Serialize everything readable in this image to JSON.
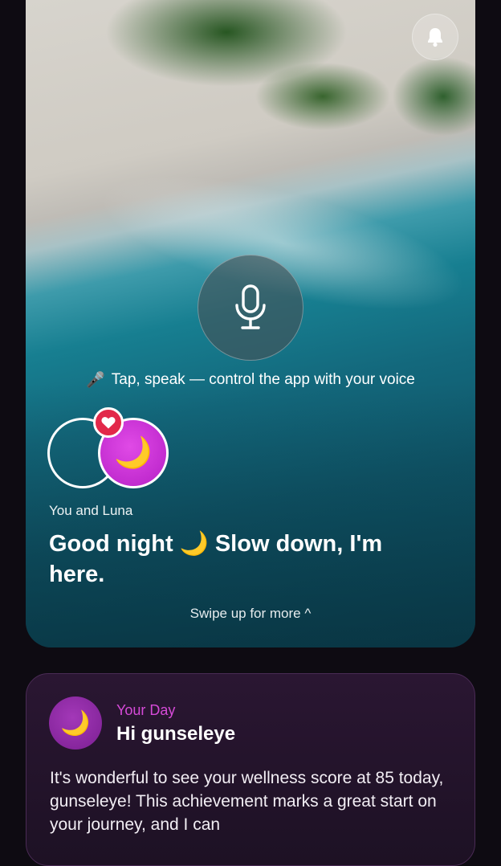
{
  "hero": {
    "voice_hint_icon": "🎤",
    "voice_hint": "Tap, speak — control the app with your voice",
    "couple_label": "You and Luna",
    "luna_avatar_emoji": "🌙",
    "greeting": "Good night 🌙 Slow down, I'm here.",
    "swipe_hint": "Swipe up for more ^"
  },
  "icons": {
    "bell": "bell-icon",
    "mic": "microphone-icon",
    "heart": "heart-icon"
  },
  "day_card": {
    "avatar_emoji": "🌙",
    "label": "Your Day",
    "title": "Hi gunseleye",
    "body": "It's wonderful to see your wellness score at 85 today, gunseleye! This achievement marks a great start on your journey, and I can"
  },
  "colors": {
    "accent_magenta": "#d64ad8",
    "heart_red": "#e2284a",
    "background": "#0e0b12"
  }
}
